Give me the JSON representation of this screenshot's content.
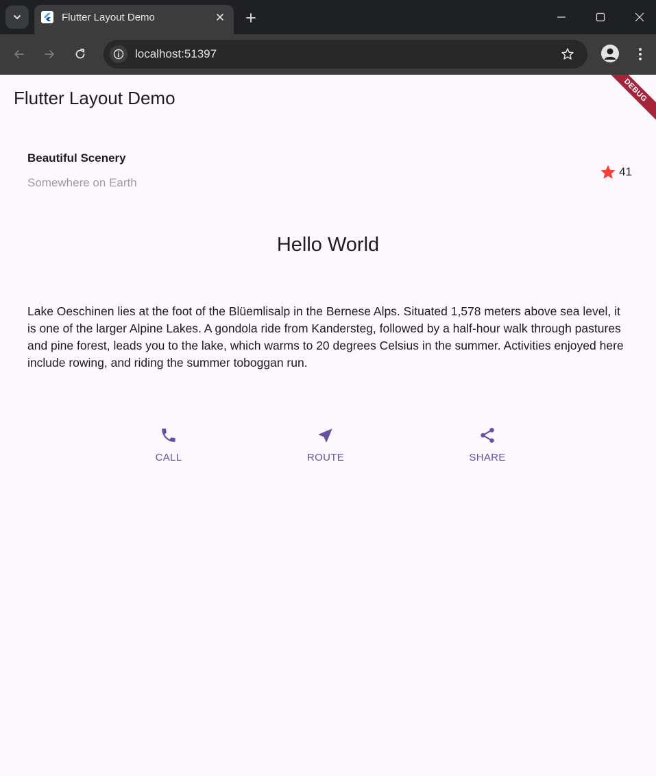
{
  "browser": {
    "tab_title": "Flutter Layout Demo",
    "url": "localhost:51397"
  },
  "app": {
    "appbar_title": "Flutter Layout Demo",
    "debug_banner": "DEBUG",
    "location": {
      "name": "Beautiful Scenery",
      "subtitle": "Somewhere on Earth",
      "favorite_count": "41"
    },
    "heading": "Hello World",
    "description": "Lake Oeschinen lies at the foot of the Blüemlisalp in the Bernese Alps. Situated 1,578 meters above sea level, it is one of the larger Alpine Lakes. A gondola ride from Kandersteg, followed by a half-hour walk through pastures and pine forest, leads you to the lake, which warms to 20 degrees Celsius in the summer. Activities enjoyed here include rowing, and riding the summer toboggan run.",
    "buttons": [
      {
        "label": "CALL",
        "icon": "phone-icon"
      },
      {
        "label": "ROUTE",
        "icon": "near-me-icon"
      },
      {
        "label": "SHARE",
        "icon": "share-icon"
      }
    ]
  },
  "colors": {
    "primary": "#6750a4",
    "star": "#f44336",
    "background": "#fdf7fe"
  }
}
